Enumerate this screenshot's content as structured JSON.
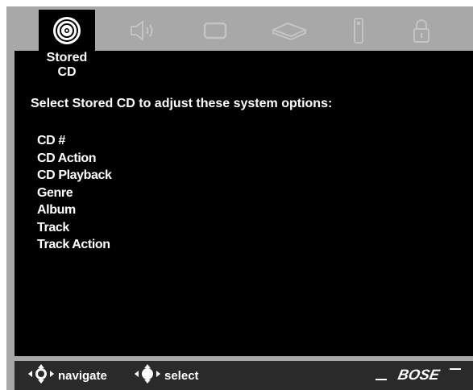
{
  "tabs": [
    {
      "icon": "stored-cd-icon",
      "active": true
    },
    {
      "icon": "speaker-icon",
      "active": false
    },
    {
      "icon": "display-icon",
      "active": false
    },
    {
      "icon": "media-center-icon",
      "active": false
    },
    {
      "icon": "remote-icon",
      "active": false
    },
    {
      "icon": "lock-icon",
      "active": false
    }
  ],
  "active_tab": {
    "line1": "Stored",
    "line2": "CD"
  },
  "main": {
    "heading": "Select Stored CD to adjust these system options:",
    "options": [
      "CD #",
      "CD Action",
      "CD Playback",
      "Genre",
      "Album",
      "Track",
      "Track Action"
    ]
  },
  "footer": {
    "navigate_label": "navigate",
    "select_label": "select",
    "brand": "BOSE"
  },
  "colors": {
    "panel": "#000000",
    "frame": "#a8a8a8",
    "inactive_icon": "#c4c4c4",
    "text": "#ffffff"
  }
}
